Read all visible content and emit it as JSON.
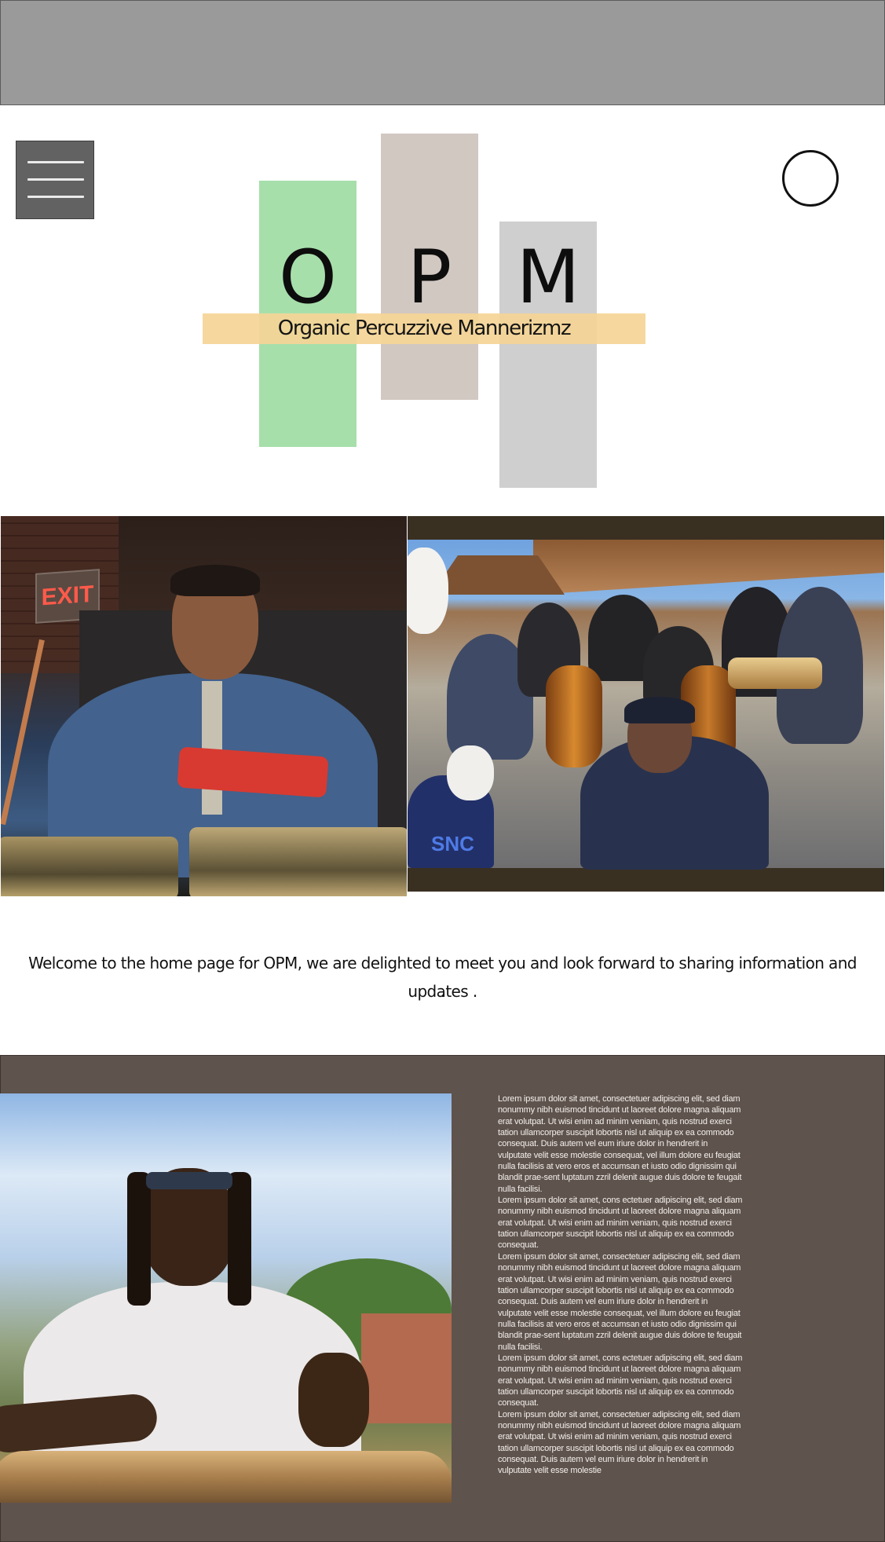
{
  "header": {
    "menu_icon": "hamburger-icon",
    "circle_icon": "circle-icon"
  },
  "logo": {
    "letters": [
      "O",
      "P",
      "M"
    ],
    "tagline": "Organic Percuzzive Mannerizmz",
    "colors": {
      "green": "#a7dfab",
      "taupe": "#d2c8c2",
      "grey": "#cfcfcf",
      "band": "#f5d596"
    }
  },
  "photos": {
    "left": {
      "sign_text": "EXIT"
    },
    "right": {
      "jersey_text": "SNC"
    }
  },
  "welcome": {
    "text": "Welcome to the home page for  OPM, we are delighted to meet you and look forward to sharing information and updates .",
    "dot": "."
  },
  "about": {
    "background_color": "#5f534d",
    "paragraphs": [
      "Lorem ipsum dolor sit amet, consectetuer adipiscing elit, sed diam nonummy nibh euismod tincidunt ut laoreet dolore magna aliquam erat volutpat. Ut wisi enim ad minim veniam, quis nostrud exerci tation ullamcorper suscipit lobortis nisl ut aliquip ex ea commodo consequat. Duis autem vel eum iriure dolor in hendrerit in vulputate velit esse molestie consequat, vel illum dolore eu feugiat nulla facilisis at vero eros et accumsan et iusto odio dignissim qui blandit prae-sent luptatum zzril delenit augue duis dolore te feugait nulla facilisi.",
      "Lorem ipsum dolor sit amet, cons ectetuer adipiscing elit, sed diam nonummy nibh euismod tincidunt ut laoreet dolore magna aliquam erat volutpat. Ut wisi enim ad minim veniam, quis nostrud exerci tation ullamcorper suscipit lobortis nisl ut aliquip ex ea commodo consequat.",
      "Lorem ipsum dolor sit amet, consectetuer adipiscing elit, sed diam nonummy nibh euismod tincidunt ut laoreet dolore magna aliquam erat volutpat. Ut wisi enim ad minim veniam, quis nostrud exerci tation ullamcorper suscipit lobortis nisl ut aliquip ex ea commodo consequat. Duis autem vel eum iriure dolor in hendrerit in vulputate velit esse molestie consequat, vel illum dolore eu feugiat nulla facilisis at vero eros et accumsan et iusto odio dignissim qui blandit prae-sent luptatum zzril delenit augue duis dolore te feugait nulla facilisi.",
      "Lorem ipsum dolor sit amet, cons ectetuer adipiscing elit, sed diam nonummy nibh euismod tincidunt ut laoreet dolore magna aliquam erat volutpat. Ut wisi enim ad minim veniam, quis nostrud exerci tation ullamcorper suscipit lobortis nisl ut aliquip ex ea commodo consequat.",
      "Lorem ipsum dolor sit amet, consectetuer adipiscing elit, sed diam nonummy nibh euismod tincidunt ut laoreet dolore magna aliquam erat volutpat. Ut wisi enim ad minim veniam, quis nostrud exerci tation ullamcorper suscipit lobortis nisl ut aliquip ex ea commodo consequat. Duis autem vel eum iriure dolor in hendrerit in vulputate velit esse molestie"
    ]
  }
}
